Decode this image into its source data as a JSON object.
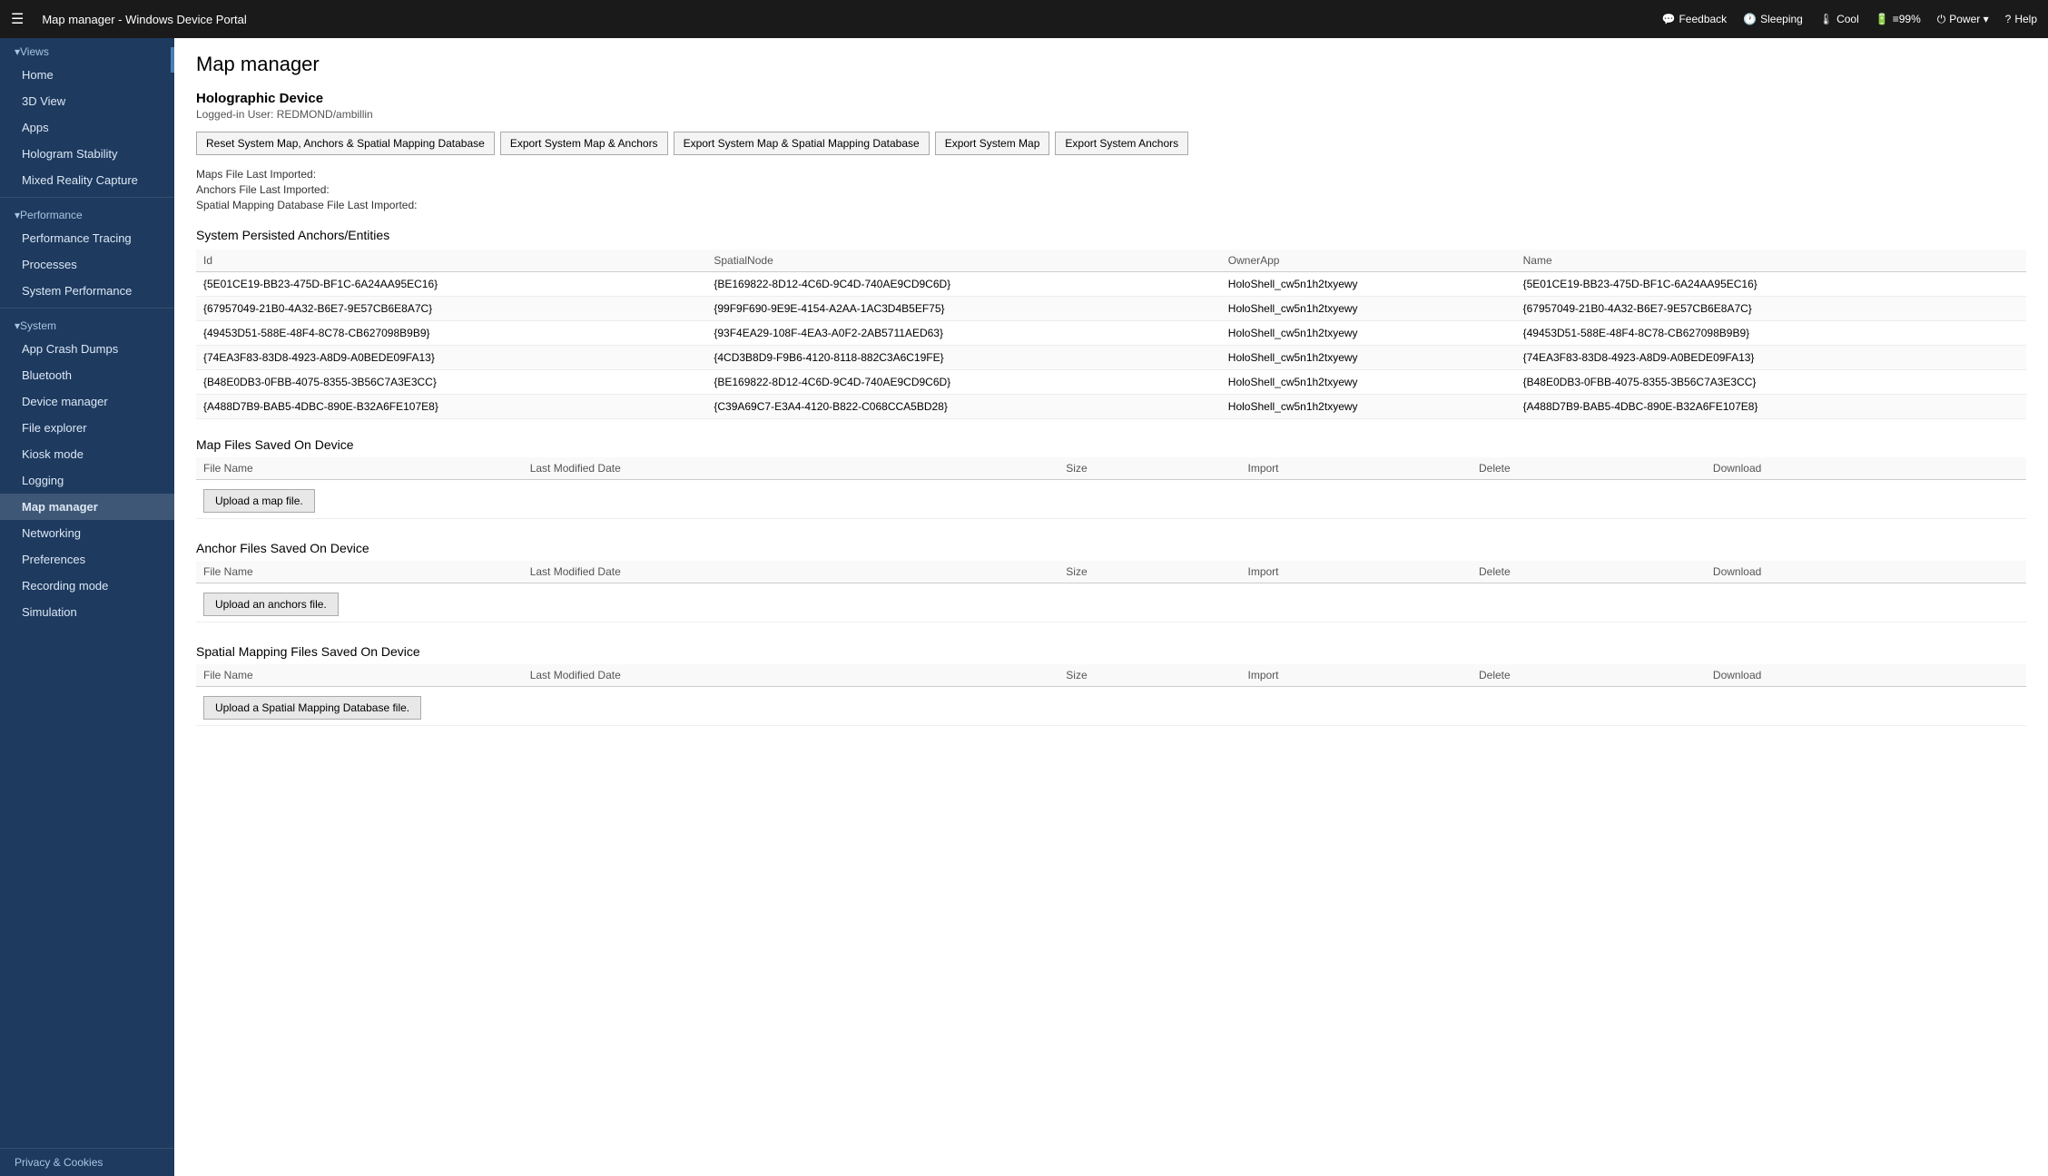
{
  "topbar": {
    "hamburger": "☰",
    "title": "Map manager - Windows Device Portal",
    "actions": [
      {
        "id": "feedback",
        "icon": "💬",
        "label": "Feedback"
      },
      {
        "id": "sleeping",
        "icon": "🕐",
        "label": "Sleeping"
      },
      {
        "id": "cool",
        "icon": "🌡",
        "label": "Cool"
      },
      {
        "id": "battery",
        "icon": "🔋",
        "label": "≡99%"
      },
      {
        "id": "power",
        "icon": "⏻",
        "label": "Power ▾"
      },
      {
        "id": "help",
        "icon": "?",
        "label": "Help"
      }
    ]
  },
  "sidebar": {
    "collapse_icon": "‹",
    "sections": [
      {
        "id": "views",
        "header": "▾Views",
        "items": [
          {
            "id": "home",
            "label": "Home",
            "active": false
          },
          {
            "id": "3d-view",
            "label": "3D View",
            "active": false
          },
          {
            "id": "apps",
            "label": "Apps",
            "active": false
          },
          {
            "id": "hologram-stability",
            "label": "Hologram Stability",
            "active": false
          },
          {
            "id": "mixed-reality-capture",
            "label": "Mixed Reality Capture",
            "active": false
          }
        ]
      },
      {
        "id": "performance",
        "header": "▾Performance",
        "items": [
          {
            "id": "performance-tracing",
            "label": "Performance Tracing",
            "active": false
          },
          {
            "id": "processes",
            "label": "Processes",
            "active": false
          },
          {
            "id": "system-performance",
            "label": "System Performance",
            "active": false
          }
        ]
      },
      {
        "id": "system",
        "header": "▾System",
        "items": [
          {
            "id": "app-crash-dumps",
            "label": "App Crash Dumps",
            "active": false
          },
          {
            "id": "bluetooth",
            "label": "Bluetooth",
            "active": false
          },
          {
            "id": "device-manager",
            "label": "Device manager",
            "active": false
          },
          {
            "id": "file-explorer",
            "label": "File explorer",
            "active": false
          },
          {
            "id": "kiosk-mode",
            "label": "Kiosk mode",
            "active": false
          },
          {
            "id": "logging",
            "label": "Logging",
            "active": false
          },
          {
            "id": "map-manager",
            "label": "Map manager",
            "active": true
          },
          {
            "id": "networking",
            "label": "Networking",
            "active": false
          },
          {
            "id": "preferences",
            "label": "Preferences",
            "active": false
          },
          {
            "id": "recording-mode",
            "label": "Recording mode",
            "active": false
          },
          {
            "id": "simulation",
            "label": "Simulation",
            "active": false
          }
        ]
      }
    ],
    "privacy_label": "Privacy & Cookies"
  },
  "main": {
    "page_title": "Map manager",
    "device": {
      "title": "Holographic Device",
      "subtitle": "Logged-in User: REDMOND/ambillin"
    },
    "buttons": [
      {
        "id": "reset-system-map",
        "label": "Reset System Map, Anchors & Spatial Mapping Database"
      },
      {
        "id": "export-map-anchors",
        "label": "Export System Map & Anchors"
      },
      {
        "id": "export-map-spatial",
        "label": "Export System Map & Spatial Mapping Database"
      },
      {
        "id": "export-system-map",
        "label": "Export System Map"
      },
      {
        "id": "export-system-anchors",
        "label": "Export System Anchors"
      }
    ],
    "info_lines": [
      {
        "id": "maps-file",
        "label": "Maps File Last Imported:"
      },
      {
        "id": "anchors-file",
        "label": "Anchors File Last Imported:"
      },
      {
        "id": "spatial-file",
        "label": "Spatial Mapping Database File Last Imported:"
      }
    ],
    "anchors_section": {
      "title": "System Persisted Anchors/Entities",
      "columns": [
        "Id",
        "SpatialNode",
        "OwnerApp",
        "Name"
      ],
      "rows": [
        {
          "id": "{5E01CE19-BB23-475D-BF1C-6A24AA95EC16}",
          "spatial_node": "{BE169822-8D12-4C6D-9C4D-740AE9CD9C6D}",
          "owner_app": "HoloShell_cw5n1h2txyewy",
          "name": "{5E01CE19-BB23-475D-BF1C-6A24AA95EC16}"
        },
        {
          "id": "{67957049-21B0-4A32-B6E7-9E57CB6E8A7C}",
          "spatial_node": "{99F9F690-9E9E-4154-A2AA-1AC3D4B5EF75}",
          "owner_app": "HoloShell_cw5n1h2txyewy",
          "name": "{67957049-21B0-4A32-B6E7-9E57CB6E8A7C}"
        },
        {
          "id": "{49453D51-588E-48F4-8C78-CB627098B9B9}",
          "spatial_node": "{93F4EA29-108F-4EA3-A0F2-2AB5711AED63}",
          "owner_app": "HoloShell_cw5n1h2txyewy",
          "name": "{49453D51-588E-48F4-8C78-CB627098B9B9}"
        },
        {
          "id": "{74EA3F83-83D8-4923-A8D9-A0BEDE09FA13}",
          "spatial_node": "{4CD3B8D9-F9B6-4120-8118-882C3A6C19FE}",
          "owner_app": "HoloShell_cw5n1h2txyewy",
          "name": "{74EA3F83-83D8-4923-A8D9-A0BEDE09FA13}"
        },
        {
          "id": "{B48E0DB3-0FBB-4075-8355-3B56C7A3E3CC}",
          "spatial_node": "{BE169822-8D12-4C6D-9C4D-740AE9CD9C6D}",
          "owner_app": "HoloShell_cw5n1h2txyewy",
          "name": "{B48E0DB3-0FBB-4075-8355-3B56C7A3E3CC}"
        },
        {
          "id": "{A488D7B9-BAB5-4DBC-890E-B32A6FE107E8}",
          "spatial_node": "{C39A69C7-E3A4-4120-B822-C068CCA5BD28}",
          "owner_app": "HoloShell_cw5n1h2txyewy",
          "name": "{A488D7B9-BAB5-4DBC-890E-B32A6FE107E8}"
        }
      ]
    },
    "map_files_section": {
      "title": "Map Files Saved On Device",
      "columns": [
        "File Name",
        "Last Modified Date",
        "Size",
        "Import",
        "Delete",
        "Download"
      ],
      "upload_label": "Upload a map file."
    },
    "anchor_files_section": {
      "title": "Anchor Files Saved On Device",
      "columns": [
        "File Name",
        "Last Modified Date",
        "Size",
        "Import",
        "Delete",
        "Download"
      ],
      "upload_label": "Upload an anchors file."
    },
    "spatial_files_section": {
      "title": "Spatial Mapping Files Saved On Device",
      "columns": [
        "File Name",
        "Last Modified Date",
        "Size",
        "Import",
        "Delete",
        "Download"
      ],
      "upload_label": "Upload a Spatial Mapping Database file."
    }
  }
}
